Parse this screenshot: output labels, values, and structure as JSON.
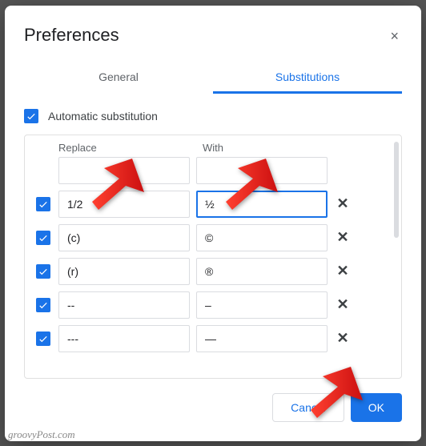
{
  "dialog": {
    "title": "Preferences",
    "close_icon": "×"
  },
  "tabs": {
    "general": "General",
    "substitutions": "Substitutions"
  },
  "auto_sub": {
    "label": "Automatic substitution"
  },
  "columns": {
    "replace": "Replace",
    "with": "With"
  },
  "rows": [
    {
      "replace": "",
      "with": "",
      "has_checkbox": false,
      "has_remove": false
    },
    {
      "replace": "1/2",
      "with": "½",
      "has_checkbox": true,
      "has_remove": true,
      "with_focused": true
    },
    {
      "replace": "(c)",
      "with": "©",
      "has_checkbox": true,
      "has_remove": true
    },
    {
      "replace": "(r)",
      "with": "®",
      "has_checkbox": true,
      "has_remove": true
    },
    {
      "replace": "--",
      "with": "–",
      "has_checkbox": true,
      "has_remove": true
    },
    {
      "replace": "---",
      "with": "—",
      "has_checkbox": true,
      "has_remove": true
    }
  ],
  "buttons": {
    "cancel": "Cancel",
    "ok": "OK"
  },
  "watermark": "groovyPost.com"
}
